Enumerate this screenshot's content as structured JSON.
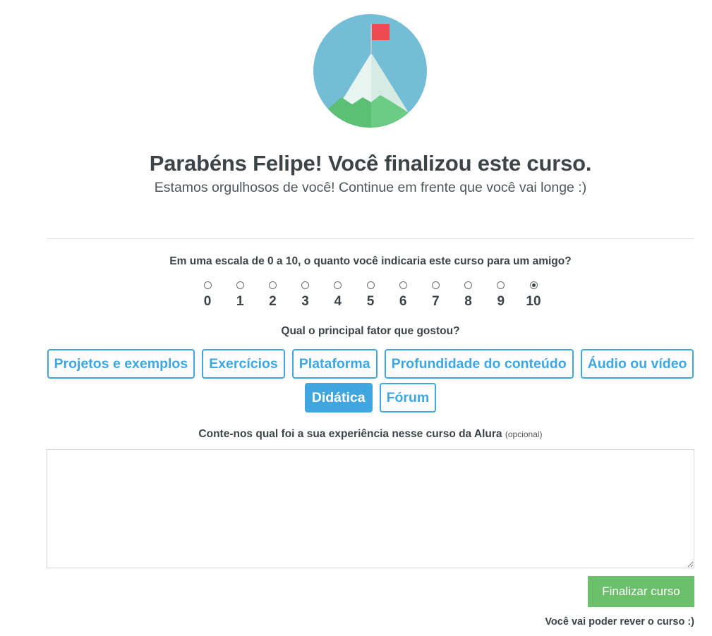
{
  "badge": {
    "icon": "mountain-flag-icon",
    "colors": {
      "sky": "#74bdd6",
      "flag": "#ef4a4f",
      "snow": "#e8f4f0",
      "hill": "#5bbf74"
    }
  },
  "header": {
    "title": "Parabéns Felipe! Você finalizou este curso.",
    "subtitle": "Estamos orgulhosos de você! Continue em frente que você vai longe :)"
  },
  "nps": {
    "question": "Em uma escala de 0 a 10, o quanto você indicaria este curso para um amigo?",
    "options": [
      "0",
      "1",
      "2",
      "3",
      "4",
      "5",
      "6",
      "7",
      "8",
      "9",
      "10"
    ],
    "selected": "10"
  },
  "factors": {
    "question": "Qual o principal fator que gostou?",
    "rows": [
      [
        "Projetos e exemplos",
        "Exercícios",
        "Plataforma",
        "Profundidade do conteúdo",
        "Áudio ou vídeo"
      ],
      [
        "Didática",
        "Fórum"
      ]
    ],
    "selected": "Didática"
  },
  "comment": {
    "label": "Conte-nos qual foi a sua experiência nesse curso da Alura",
    "optional": "(opcional)",
    "value": ""
  },
  "actions": {
    "finish_label": "Finalizar curso",
    "review_note": "Você vai poder rever o curso :)"
  },
  "colors": {
    "accent": "#3fa6e0",
    "success": "#6cc06b",
    "text": "#3d4448"
  }
}
